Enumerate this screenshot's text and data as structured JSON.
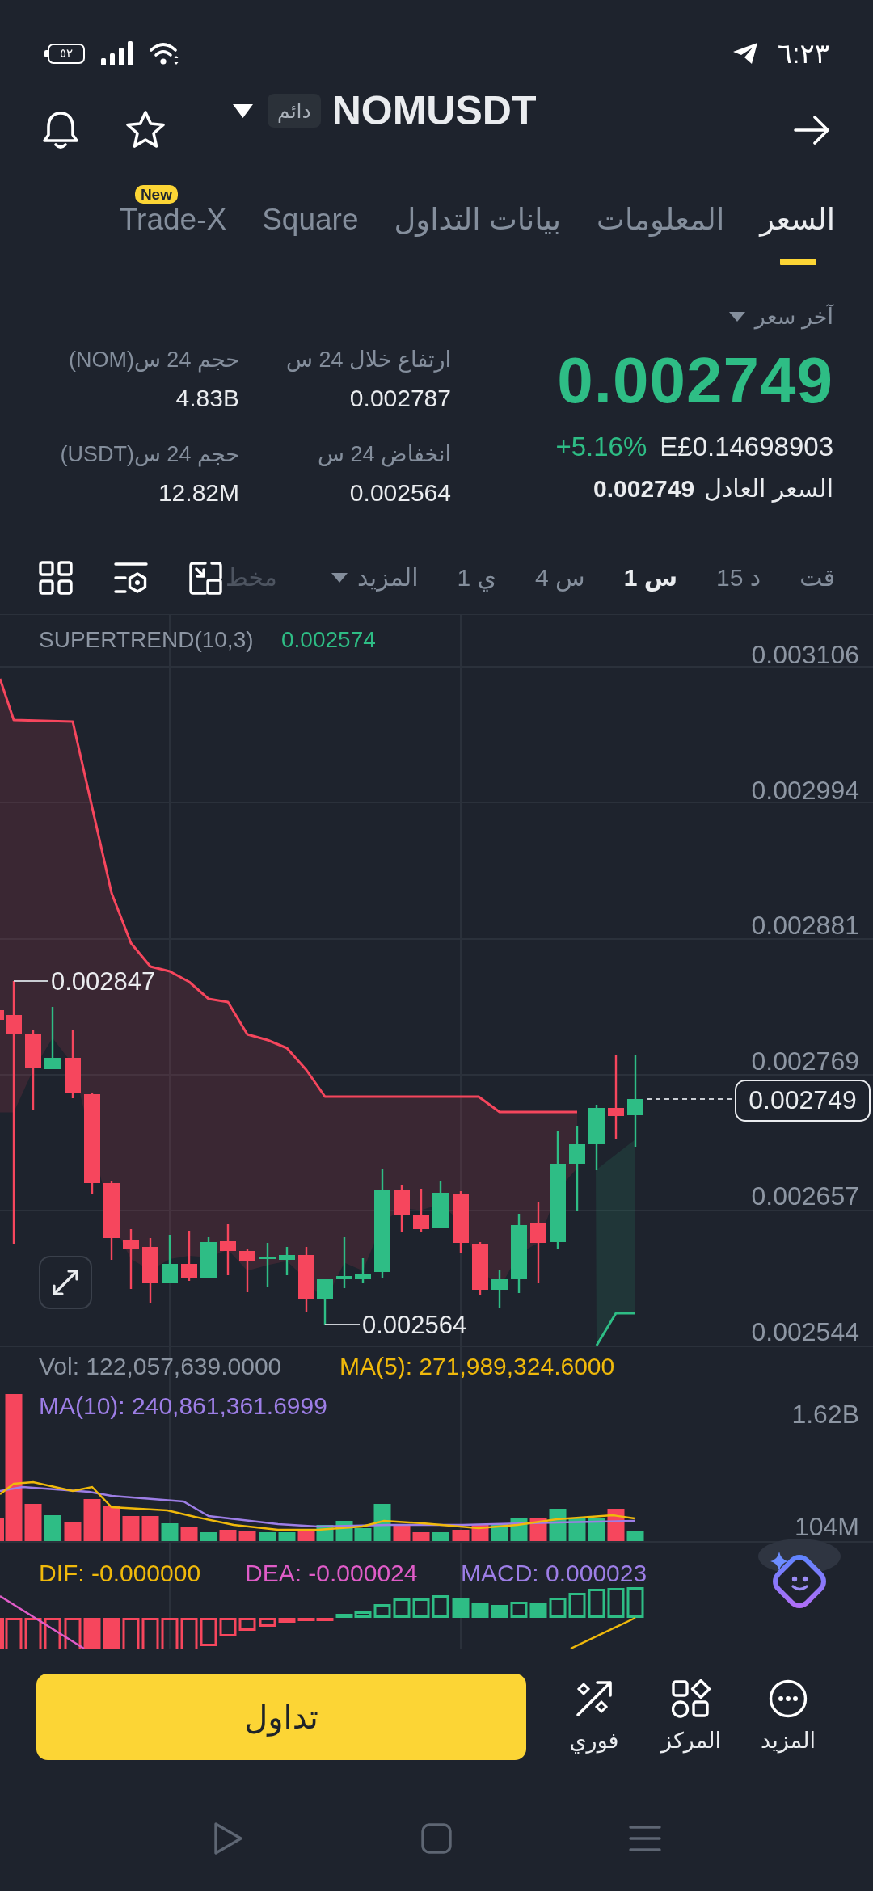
{
  "status_bar": {
    "battery": "٥٢",
    "time": "٦:٢٣"
  },
  "header": {
    "badge": "دائم",
    "title": "NOMUSDT"
  },
  "tabs": [
    {
      "label": "السعر",
      "selected": true
    },
    {
      "label": "المعلومات",
      "selected": false
    },
    {
      "label": "بيانات التداول",
      "selected": false
    },
    {
      "label": "Square",
      "selected": false
    },
    {
      "label": "Trade-X",
      "selected": false,
      "badge": "New"
    }
  ],
  "price": {
    "label": "آخر سعر",
    "last": "0.002749",
    "rising": true,
    "change": "+5.16%",
    "local": "E£0.14698903",
    "fair_label": "السعر العادل",
    "fair": "0.002749"
  },
  "stats": [
    {
      "label": "ارتفاع خلال 24 س",
      "value": "0.002787"
    },
    {
      "label": "حجم 24 س(NOM)",
      "value": "4.83B"
    },
    {
      "label": "انخفاض 24 س",
      "value": "0.002564"
    },
    {
      "label": "حجم 24 س(USDT)",
      "value": "12.82M"
    }
  ],
  "intervals": [
    {
      "label": "قت",
      "kind": "interval",
      "selected": false
    },
    {
      "label": "15 د",
      "kind": "interval",
      "selected": false
    },
    {
      "label": "1 س",
      "kind": "interval",
      "selected": true
    },
    {
      "label": "4 س",
      "kind": "interval",
      "selected": false
    },
    {
      "label": "1 ي",
      "kind": "interval",
      "selected": false
    },
    {
      "label": "المزيد",
      "kind": "menu",
      "selected": false
    }
  ],
  "chart_tab_partial": "مخط",
  "chart": {
    "indicator": "SUPERTREND(10,3)",
    "indicator_value": "0.002574",
    "price_axis": [
      "0.003106",
      "0.002994",
      "0.002881",
      "0.002769",
      "0.002657",
      "0.002544"
    ],
    "high_label": "0.002847",
    "low_label": "0.002564",
    "current_price": "0.002749"
  },
  "volume": {
    "vol": "Vol: 122,057,639.0000",
    "ma5": "MA(5): 271,989,324.6000",
    "ma10": "MA(10): 240,861,361.6999",
    "axis": [
      "1.62B",
      "104M"
    ]
  },
  "macd": {
    "dif": "DIF: -0.000000",
    "dea": "DEA: -0.000024",
    "macd": "MACD: 0.000023"
  },
  "bottom_bar": {
    "trade_button": "تداول",
    "actions": [
      {
        "label": "المزيد",
        "kind": "more"
      },
      {
        "label": "المركز",
        "kind": "positions"
      },
      {
        "label": "فوري",
        "kind": "spot"
      }
    ]
  }
}
